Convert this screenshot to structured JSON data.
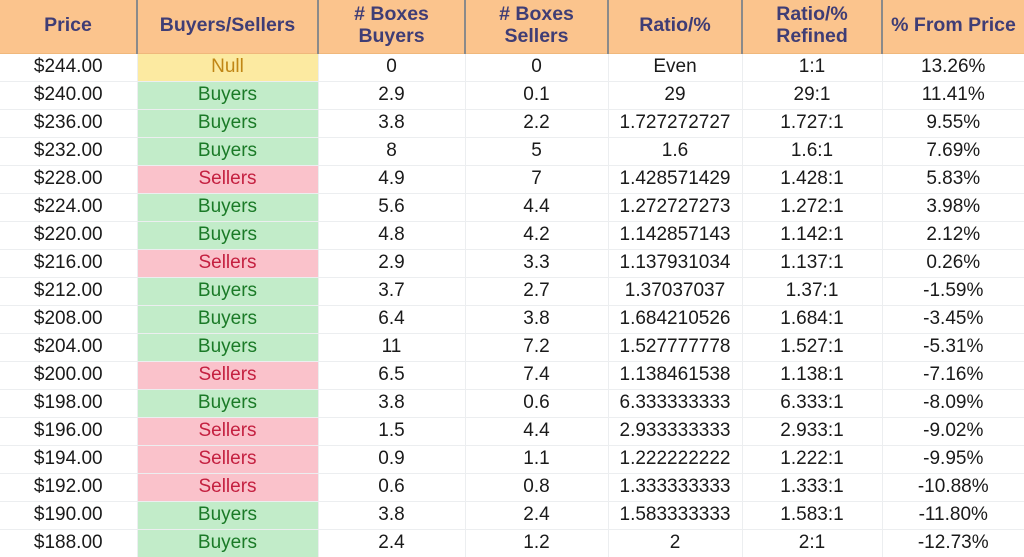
{
  "table": {
    "name": "buyers-sellers-price-ladder",
    "columns": [
      {
        "key": "price",
        "label": "Price"
      },
      {
        "key": "buyers_sellers",
        "label": "Buyers/Sellers"
      },
      {
        "key": "boxes_buyers",
        "label": "# Boxes Buyers"
      },
      {
        "key": "boxes_sellers",
        "label": "# Boxes Sellers"
      },
      {
        "key": "ratio",
        "label": "Ratio/%"
      },
      {
        "key": "ratio_refined",
        "label": "Ratio/%\nRefined"
      },
      {
        "key": "pct_from_price",
        "label": "% From Price"
      }
    ],
    "header_labels": {
      "price": "Price",
      "buyers_sellers": "Buyers/Sellers",
      "boxes_buyers": "# Boxes Buyers",
      "boxes_sellers": "# Boxes Sellers",
      "ratio": "Ratio/%",
      "ratio_refined_line1": "Ratio/%",
      "ratio_refined_line2": "Refined",
      "pct_from_price": "% From Price"
    },
    "colors": {
      "header_background": "#fbc48d",
      "header_text": "#3f3d75",
      "header_divider": "#8a8a8a",
      "row_divider": "#eceef0",
      "buyers_background": "#c2ecc9",
      "buyers_text": "#1a7a27",
      "sellers_background": "#fac2cb",
      "sellers_text": "#c42040",
      "null_background": "#fceaa1",
      "null_text": "#c08615",
      "body_text": "#1a1a1a",
      "page_background": "#ffffff"
    },
    "rows": [
      {
        "price": "$244.00",
        "buyers_sellers": "Null",
        "state": "null",
        "boxes_buyers": "0",
        "boxes_sellers": "0",
        "ratio": "Even",
        "ratio_refined": "1:1",
        "pct_from_price": "13.26%"
      },
      {
        "price": "$240.00",
        "buyers_sellers": "Buyers",
        "state": "buyers",
        "boxes_buyers": "2.9",
        "boxes_sellers": "0.1",
        "ratio": "29",
        "ratio_refined": "29:1",
        "pct_from_price": "11.41%"
      },
      {
        "price": "$236.00",
        "buyers_sellers": "Buyers",
        "state": "buyers",
        "boxes_buyers": "3.8",
        "boxes_sellers": "2.2",
        "ratio": "1.727272727",
        "ratio_refined": "1.727:1",
        "pct_from_price": "9.55%"
      },
      {
        "price": "$232.00",
        "buyers_sellers": "Buyers",
        "state": "buyers",
        "boxes_buyers": "8",
        "boxes_sellers": "5",
        "ratio": "1.6",
        "ratio_refined": "1.6:1",
        "pct_from_price": "7.69%"
      },
      {
        "price": "$228.00",
        "buyers_sellers": "Sellers",
        "state": "sellers",
        "boxes_buyers": "4.9",
        "boxes_sellers": "7",
        "ratio": "1.428571429",
        "ratio_refined": "1.428:1",
        "pct_from_price": "5.83%"
      },
      {
        "price": "$224.00",
        "buyers_sellers": "Buyers",
        "state": "buyers",
        "boxes_buyers": "5.6",
        "boxes_sellers": "4.4",
        "ratio": "1.272727273",
        "ratio_refined": "1.272:1",
        "pct_from_price": "3.98%"
      },
      {
        "price": "$220.00",
        "buyers_sellers": "Buyers",
        "state": "buyers",
        "boxes_buyers": "4.8",
        "boxes_sellers": "4.2",
        "ratio": "1.142857143",
        "ratio_refined": "1.142:1",
        "pct_from_price": "2.12%"
      },
      {
        "price": "$216.00",
        "buyers_sellers": "Sellers",
        "state": "sellers",
        "boxes_buyers": "2.9",
        "boxes_sellers": "3.3",
        "ratio": "1.137931034",
        "ratio_refined": "1.137:1",
        "pct_from_price": "0.26%"
      },
      {
        "price": "$212.00",
        "buyers_sellers": "Buyers",
        "state": "buyers",
        "boxes_buyers": "3.7",
        "boxes_sellers": "2.7",
        "ratio": "1.37037037",
        "ratio_refined": "1.37:1",
        "pct_from_price": "-1.59%"
      },
      {
        "price": "$208.00",
        "buyers_sellers": "Buyers",
        "state": "buyers",
        "boxes_buyers": "6.4",
        "boxes_sellers": "3.8",
        "ratio": "1.684210526",
        "ratio_refined": "1.684:1",
        "pct_from_price": "-3.45%"
      },
      {
        "price": "$204.00",
        "buyers_sellers": "Buyers",
        "state": "buyers",
        "boxes_buyers": "11",
        "boxes_sellers": "7.2",
        "ratio": "1.527777778",
        "ratio_refined": "1.527:1",
        "pct_from_price": "-5.31%"
      },
      {
        "price": "$200.00",
        "buyers_sellers": "Sellers",
        "state": "sellers",
        "boxes_buyers": "6.5",
        "boxes_sellers": "7.4",
        "ratio": "1.138461538",
        "ratio_refined": "1.138:1",
        "pct_from_price": "-7.16%"
      },
      {
        "price": "$198.00",
        "buyers_sellers": "Buyers",
        "state": "buyers",
        "boxes_buyers": "3.8",
        "boxes_sellers": "0.6",
        "ratio": "6.333333333",
        "ratio_refined": "6.333:1",
        "pct_from_price": "-8.09%"
      },
      {
        "price": "$196.00",
        "buyers_sellers": "Sellers",
        "state": "sellers",
        "boxes_buyers": "1.5",
        "boxes_sellers": "4.4",
        "ratio": "2.933333333",
        "ratio_refined": "2.933:1",
        "pct_from_price": "-9.02%"
      },
      {
        "price": "$194.00",
        "buyers_sellers": "Sellers",
        "state": "sellers",
        "boxes_buyers": "0.9",
        "boxes_sellers": "1.1",
        "ratio": "1.222222222",
        "ratio_refined": "1.222:1",
        "pct_from_price": "-9.95%"
      },
      {
        "price": "$192.00",
        "buyers_sellers": "Sellers",
        "state": "sellers",
        "boxes_buyers": "0.6",
        "boxes_sellers": "0.8",
        "ratio": "1.333333333",
        "ratio_refined": "1.333:1",
        "pct_from_price": "-10.88%"
      },
      {
        "price": "$190.00",
        "buyers_sellers": "Buyers",
        "state": "buyers",
        "boxes_buyers": "3.8",
        "boxes_sellers": "2.4",
        "ratio": "1.583333333",
        "ratio_refined": "1.583:1",
        "pct_from_price": "-11.80%"
      },
      {
        "price": "$188.00",
        "buyers_sellers": "Buyers",
        "state": "buyers",
        "boxes_buyers": "2.4",
        "boxes_sellers": "1.2",
        "ratio": "2",
        "ratio_refined": "2:1",
        "pct_from_price": "-12.73%"
      }
    ]
  }
}
